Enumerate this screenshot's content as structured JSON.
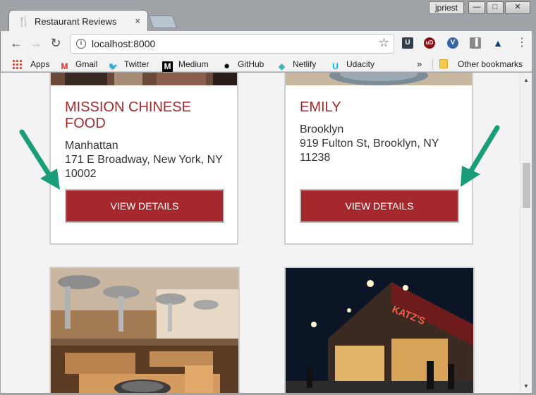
{
  "window": {
    "user": "jpriest",
    "min_glyph": "—",
    "max_glyph": "□",
    "close_glyph": "✕"
  },
  "tab": {
    "title": "Restaurant Reviews",
    "icon_glyph": "🍴",
    "close_glyph": "×"
  },
  "toolbar": {
    "back_glyph": "←",
    "forward_glyph": "→",
    "reload_glyph": "↻",
    "url": "localhost:8000",
    "info_glyph": "i",
    "star_glyph": "☆",
    "menu_glyph": "⋮",
    "extensions": [
      "U",
      "uD",
      "V",
      "▐",
      "▲"
    ]
  },
  "bookmarks": {
    "items": [
      {
        "label": "Apps",
        "icon": "apps-grid-icon"
      },
      {
        "label": "Gmail",
        "icon": "gmail-icon",
        "glyph": "M",
        "color": "#d93025"
      },
      {
        "label": "Twitter",
        "icon": "twitter-icon",
        "glyph": "🐦",
        "color": "#1da1f2"
      },
      {
        "label": "Medium",
        "icon": "medium-icon",
        "glyph": "M",
        "color": "#000000"
      },
      {
        "label": "GitHub",
        "icon": "github-icon",
        "glyph": "●",
        "color": "#111111"
      },
      {
        "label": "Netlify",
        "icon": "netlify-icon",
        "glyph": "◆",
        "color": "#3bb9b1"
      },
      {
        "label": "Udacity",
        "icon": "udacity-icon",
        "glyph": "U",
        "color": "#02b3e4"
      }
    ],
    "overflow": "»",
    "other": "Other bookmarks"
  },
  "restaurants": [
    {
      "name_line1": "MISSION CHINESE",
      "name_line2": "FOOD",
      "neighborhood": "Manhattan",
      "address_line1": "171 E Broadway, New York, NY",
      "address_line2": "10002",
      "button": "VIEW DETAILS"
    },
    {
      "name_line1": "EMILY",
      "neighborhood": "Brooklyn",
      "address_line1": "919 Fulton St, Brooklyn, NY",
      "address_line2": "11238",
      "button": "VIEW DETAILS"
    }
  ],
  "colors": {
    "accent": "#a5282d",
    "restaurant_name": "#9e2b2e",
    "annotation_arrow": "#1a9e7a"
  }
}
